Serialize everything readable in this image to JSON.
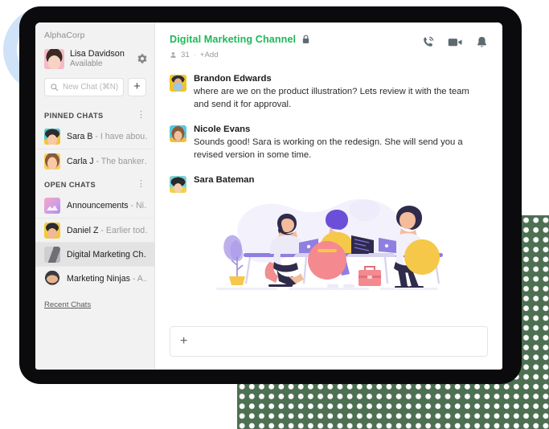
{
  "sidebar": {
    "org_name": "AlphaCorp",
    "user": {
      "name": "Lisa Davidson",
      "status": "Available",
      "avatar": "lisa-avatar"
    },
    "settings_icon": "gear-icon",
    "search": {
      "placeholder": "New Chat (⌘N)",
      "value": "",
      "icon": "search-icon"
    },
    "add_button_label": "+",
    "sections": [
      {
        "title": "PINNED CHATS",
        "menu_icon": "kebab-menu-icon",
        "items": [
          {
            "name": "Sara B",
            "preview": "- I have abou…",
            "avatar": "sara-b-avatar",
            "selected": false
          },
          {
            "name": "Carla J",
            "preview": "- The banker…",
            "avatar": "carla-j-avatar",
            "selected": false
          }
        ]
      },
      {
        "title": "OPEN CHATS",
        "menu_icon": "kebab-menu-icon",
        "items": [
          {
            "name": "Announcements",
            "preview": "- Ni…",
            "avatar": "announcements-avatar",
            "selected": false
          },
          {
            "name": "Daniel Z",
            "preview": "- Earlier tod…",
            "avatar": "daniel-z-avatar",
            "selected": false
          },
          {
            "name": "Digital Marketing Ch…",
            "preview": "",
            "avatar": "digital-marketing-avatar",
            "selected": true
          },
          {
            "name": "Marketing Ninjas",
            "preview": "- A…",
            "avatar": "marketing-ninjas-avatar",
            "selected": false
          }
        ]
      }
    ],
    "recent_link": "Recent Chats"
  },
  "header": {
    "channel_title": "Digital Marketing Channel",
    "lock_icon": "lock-icon",
    "members_icon": "person-icon",
    "member_count": "31",
    "separator": "·",
    "add_label": "+Add",
    "actions": [
      {
        "icon": "phone-call-icon",
        "label": "call"
      },
      {
        "icon": "video-camera-icon",
        "label": "video"
      },
      {
        "icon": "bell-icon",
        "label": "notifications"
      }
    ]
  },
  "messages": [
    {
      "author": "Brandon Edwards",
      "avatar": "brandon-avatar",
      "text": "where are we on the product illustration? Lets review it with the team and send it for approval."
    },
    {
      "author": "Nicole Evans",
      "avatar": "nicole-avatar",
      "text": "Sounds good! Sara is working on the redesign. She will send you a revised version in some time."
    },
    {
      "author": "Sara Bateman",
      "avatar": "sara-bateman-avatar",
      "text": "",
      "attachment": "team-working-illustration"
    }
  ],
  "composer": {
    "placeholder": "",
    "value": "",
    "add_icon": "plus-icon"
  },
  "colors": {
    "accent_green": "#1cb957",
    "sidebar_bg": "#f2f2f2",
    "selected_row": "#e3e3e3",
    "frame_dark": "#0b0b0d",
    "ring_blue": "#cfe2f7",
    "dots_green": "#4d6f52"
  }
}
